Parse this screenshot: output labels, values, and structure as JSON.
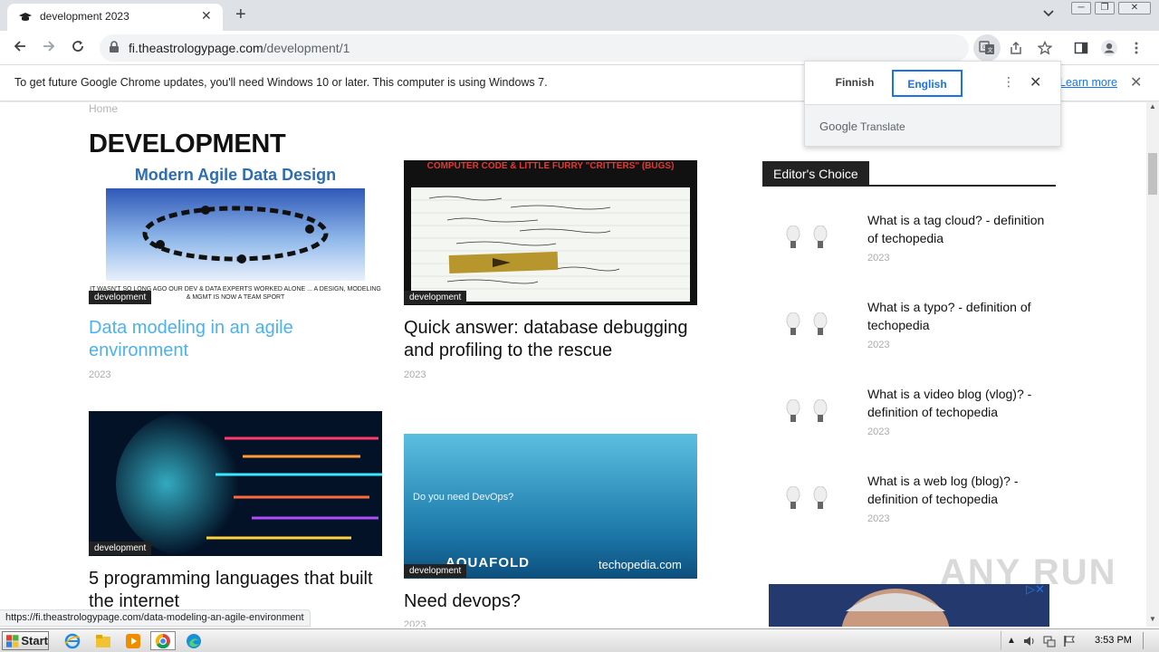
{
  "browser": {
    "tab_title": "development 2023",
    "url_host": "fi.theastrologypage.com",
    "url_path": "/development/1",
    "infobar_message": "To get future Google Chrome updates, you'll need Windows 10 or later. This computer is using Windows 7.",
    "infobar_link": "Learn more",
    "status_url": "https://fi.theastrologypage.com/data-modeling-an-agile-environment"
  },
  "translate": {
    "source_lang": "Finnish",
    "target_lang": "English",
    "brand_google": "Google",
    "brand_translate": "Translate"
  },
  "page": {
    "breadcrumb": "Home",
    "title": "DEVELOPMENT",
    "posts": [
      {
        "title": "Data modeling in an agile environment",
        "category": "development",
        "date": "2023",
        "image_heading": "Modern Agile Data Design",
        "image_caption": "IT WASN'T SO LONG AGO OUR DEV & DATA EXPERTS WORKED ALONE ... A DESIGN, MODELING & MGMT IS NOW A TEAM SPORT"
      },
      {
        "title": "Quick answer: database debugging and profiling to the rescue",
        "category": "development",
        "date": "2023",
        "image_heading": "COMPUTER CODE & LITTLE FURRY \"CRITTERS\" (BUGS)"
      },
      {
        "title": "5 programming languages that built the internet",
        "category": "development",
        "date": ""
      },
      {
        "title": "Need devops?",
        "category": "development",
        "date": "2023",
        "image_text": "Do you need DevOps?",
        "image_brand_left": "AQUAFOLD",
        "image_brand_right": "techopedia.com"
      }
    ]
  },
  "sidebar": {
    "header": "Editor's Choice",
    "items": [
      {
        "title": "What is a tag cloud? - definition of techopedia",
        "date": "2023"
      },
      {
        "title": "What is a typo? - definition of techopedia",
        "date": "2023"
      },
      {
        "title": "What is a video blog (vlog)? - definition of techopedia",
        "date": "2023"
      },
      {
        "title": "What is a web log (blog)? - definition of techopedia",
        "date": "2023"
      }
    ]
  },
  "taskbar": {
    "start_label": "Start",
    "clock": "3:53 PM"
  },
  "watermark": "ANY RUN",
  "colors": {
    "link_active": "#4db2ec",
    "badge_bg": "#222222",
    "chrome_blue": "#1a73e8"
  }
}
